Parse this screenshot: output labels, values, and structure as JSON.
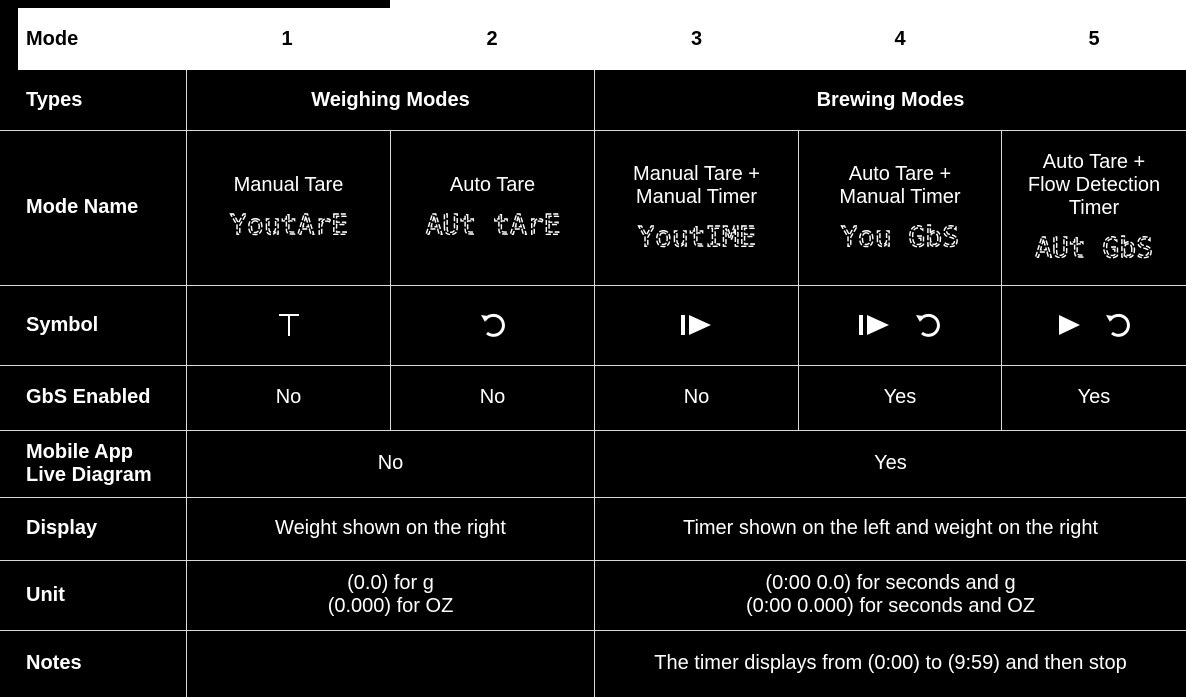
{
  "header": {
    "mode_label": "Mode",
    "modes": [
      "1",
      "2",
      "3",
      "4",
      "5"
    ]
  },
  "types": {
    "label": "Types",
    "weighing": "Weighing Modes",
    "brewing": "Brewing Modes"
  },
  "mode_name": {
    "label": "Mode Name",
    "names": [
      "Manual Tare",
      "Auto Tare",
      "Manual Tare + Manual Timer",
      "Auto Tare + Manual Timer",
      "Auto Tare + Flow Detection Timer"
    ],
    "names_lines": [
      [
        "Manual Tare"
      ],
      [
        "Auto Tare"
      ],
      [
        "Manual Tare +",
        "Manual Timer"
      ],
      [
        "Auto Tare +",
        "Manual Timer"
      ],
      [
        "Auto Tare +",
        "Flow Detection",
        "Timer"
      ]
    ],
    "display_codes": [
      "YoutArE",
      "AUt tArE",
      "YoutIME",
      "You GbS",
      "AUt GbS"
    ]
  },
  "symbol": {
    "label": "Symbol",
    "icons": [
      [
        "tare-t-icon"
      ],
      [
        "circular-arrow-icon"
      ],
      [
        "bar-play-icon"
      ],
      [
        "bar-play-icon",
        "circular-arrow-icon"
      ],
      [
        "play-icon",
        "circular-arrow-icon"
      ]
    ]
  },
  "gbs": {
    "label": "GbS Enabled",
    "values": [
      "No",
      "No",
      "No",
      "Yes",
      "Yes"
    ]
  },
  "mobile": {
    "label_lines": [
      "Mobile App",
      "Live Diagram"
    ],
    "weighing": "No",
    "brewing": "Yes"
  },
  "display": {
    "label": "Display",
    "weighing": "Weight shown on the right",
    "brewing": "Timer shown on the left and weight on the right"
  },
  "unit": {
    "label": "Unit",
    "weighing_lines": [
      "(0.0) for g",
      "(0.000) for OZ"
    ],
    "brewing_lines": [
      "(0:00 0.0) for seconds and g",
      "(0:00 0.000) for seconds and OZ"
    ]
  },
  "notes": {
    "label": "Notes",
    "weighing": "",
    "brewing": "The timer displays from (0:00) to (9:59) and then stop"
  }
}
